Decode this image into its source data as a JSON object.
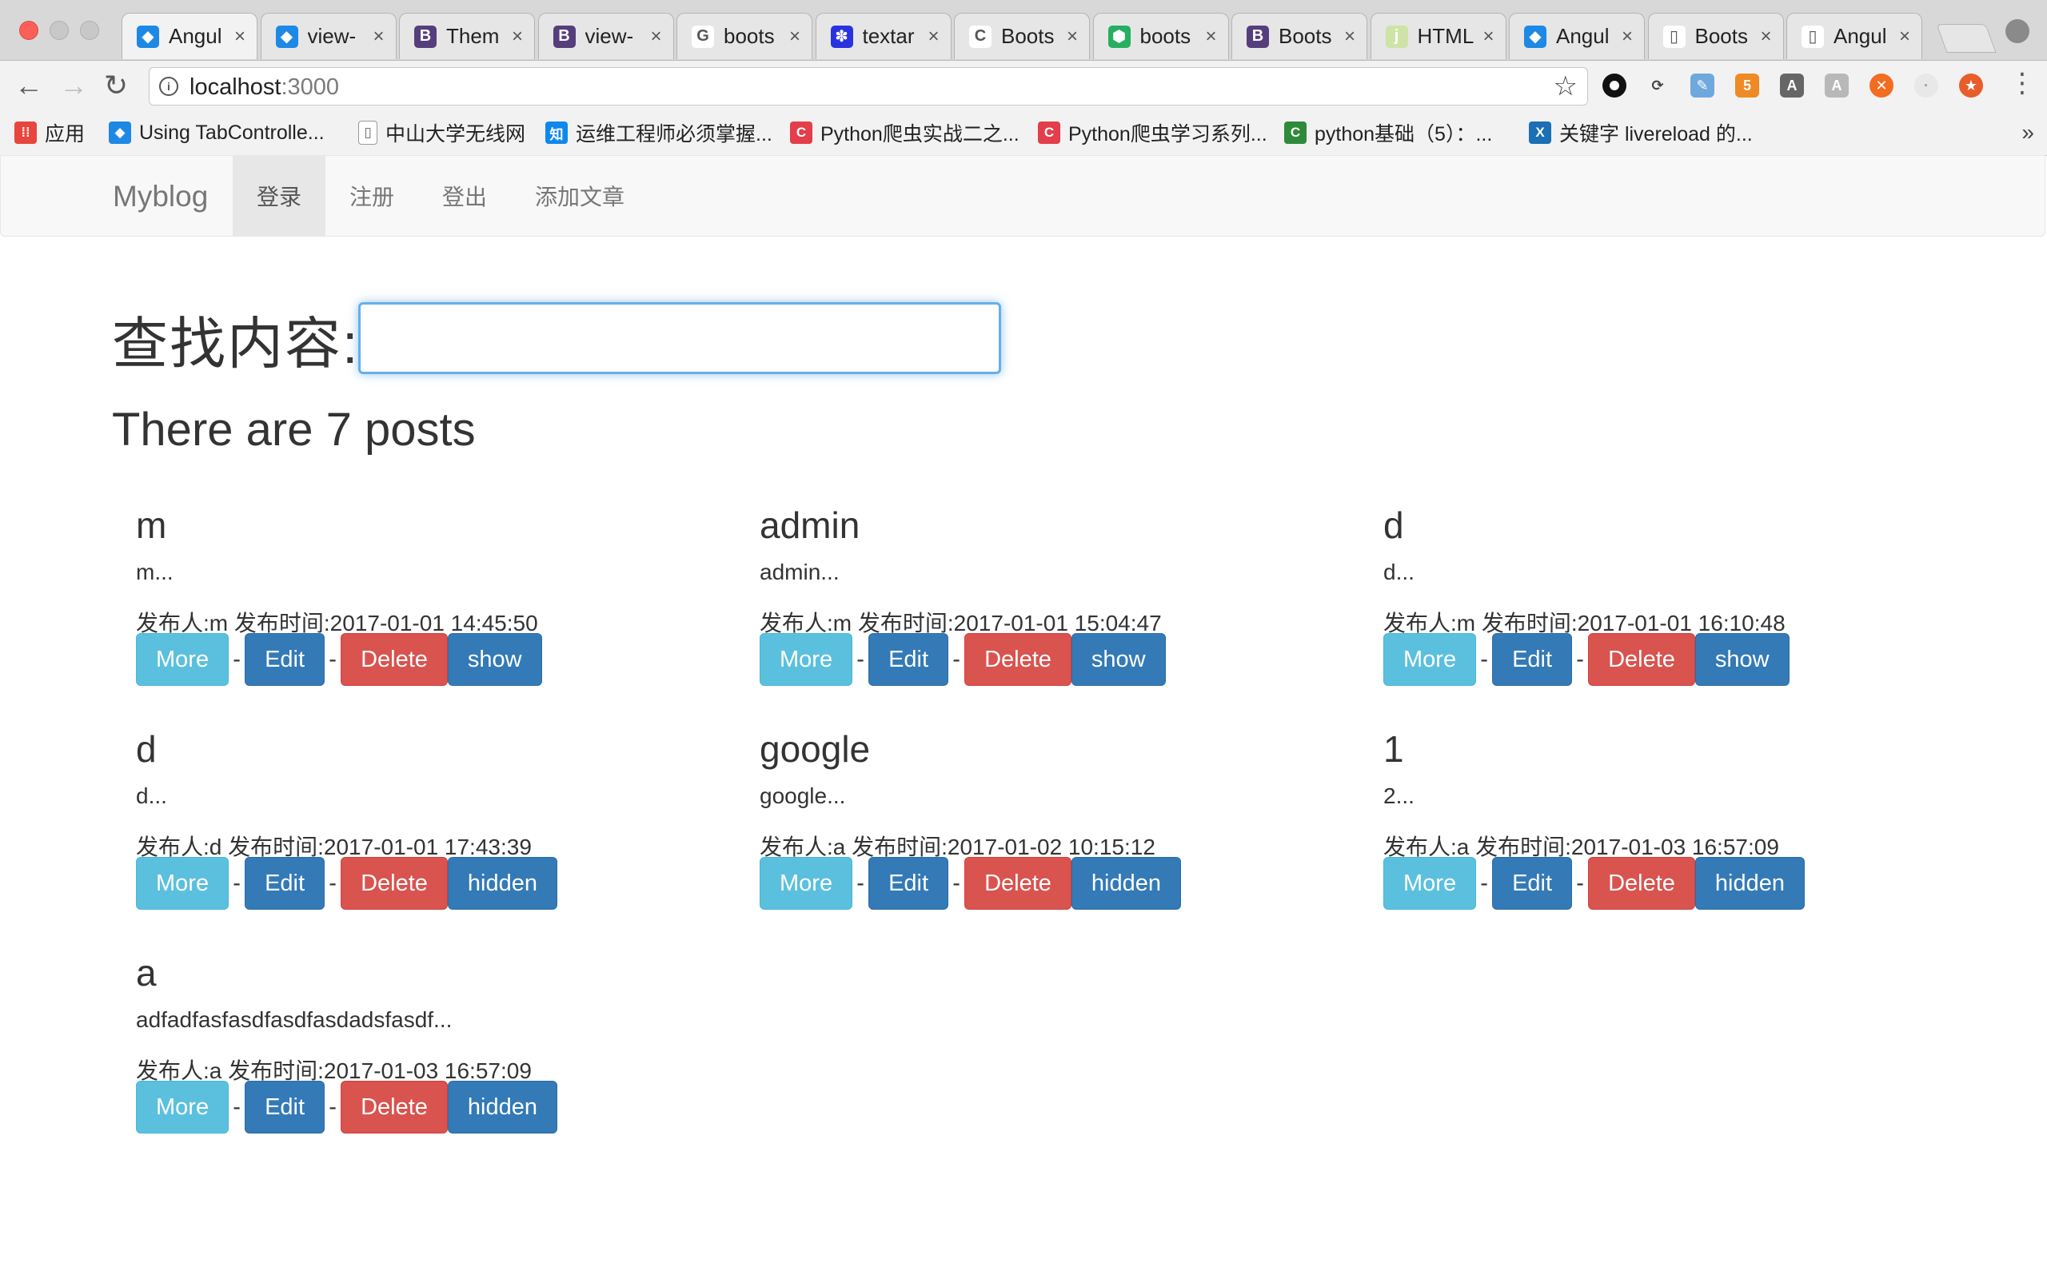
{
  "browser": {
    "tabs": [
      {
        "title": "Angul",
        "icon": "angular-icon",
        "color": "#1e88e5",
        "glyph": "◆"
      },
      {
        "title": "view-",
        "icon": "angular-icon",
        "color": "#1e88e5",
        "glyph": "◆"
      },
      {
        "title": "Them",
        "icon": "bootstrap-icon",
        "color": "#563d7c",
        "glyph": "B"
      },
      {
        "title": "view-",
        "icon": "bootstrap-icon",
        "color": "#563d7c",
        "glyph": "B"
      },
      {
        "title": "boots",
        "icon": "google-icon",
        "color": "#ffffff",
        "glyph": "G"
      },
      {
        "title": "textar",
        "icon": "baidu-icon",
        "color": "#2932e1",
        "glyph": "✽"
      },
      {
        "title": "Boots",
        "icon": "cnblogs-icon",
        "color": "#ffffff",
        "glyph": "C"
      },
      {
        "title": "boots",
        "icon": "hex-icon",
        "color": "#27ae60",
        "glyph": "⬢"
      },
      {
        "title": "Boots",
        "icon": "bootstrap-icon",
        "color": "#563d7c",
        "glyph": "B"
      },
      {
        "title": "HTML",
        "icon": "jsfiddle-icon",
        "color": "#cde4a6",
        "glyph": "j"
      },
      {
        "title": "Angul",
        "icon": "angular-icon",
        "color": "#1e88e5",
        "glyph": "◆"
      },
      {
        "title": "Boots",
        "icon": "page-icon",
        "color": "#ffffff",
        "glyph": "▯"
      },
      {
        "title": "Angul",
        "icon": "page-icon",
        "color": "#ffffff",
        "glyph": "▯"
      }
    ],
    "close_glyph": "×",
    "url_host": "localhost",
    "url_port": ":3000",
    "info_glyph": "i",
    "star_glyph": "☆",
    "back_glyph": "←",
    "forward_glyph": "→",
    "reload_glyph": "↻",
    "bookmarks": [
      {
        "label": "应用",
        "icon": "apps-grid-icon",
        "color": "#e8453c",
        "glyph": "⁞⁞"
      },
      {
        "label": "Using TabControlle...",
        "icon": "angular-icon",
        "color": "#1e88e5",
        "glyph": "◆"
      },
      {
        "label": "中山大学无线网",
        "icon": "page-icon",
        "color": "#ffffff",
        "glyph": "▯"
      },
      {
        "label": "运维工程师必须掌握...",
        "icon": "zhihu-icon",
        "color": "#0f88eb",
        "glyph": "知"
      },
      {
        "label": "Python爬虫实战二之...",
        "icon": "cnblogs-icon",
        "color": "#e33e4b",
        "glyph": "C"
      },
      {
        "label": "Python爬虫学习系列...",
        "icon": "cnblogs-icon",
        "color": "#e33e4b",
        "glyph": "C"
      },
      {
        "label": "python基础（5）：...",
        "icon": "csdn-icon",
        "color": "#2e8b3a",
        "glyph": "C"
      },
      {
        "label": "关键字 livereload 的...",
        "icon": "x-icon",
        "color": "#1a6fb5",
        "glyph": "X"
      }
    ],
    "bookmarks_more": "»"
  },
  "navbar": {
    "brand": "Myblog",
    "items": [
      {
        "label": "登录",
        "active": true
      },
      {
        "label": "注册",
        "active": false
      },
      {
        "label": "登出",
        "active": false
      },
      {
        "label": "添加文章",
        "active": false
      }
    ]
  },
  "search": {
    "label": "查找内容:",
    "value": ""
  },
  "post_count_text": "There are 7 posts",
  "buttons": {
    "more": "More",
    "edit": "Edit",
    "delete": "Delete",
    "separator": "-"
  },
  "posts": [
    {
      "title": "m",
      "excerpt": "m...",
      "meta": "发布人:m 发布时间:2017-01-01 14:45:50",
      "toggle": "show"
    },
    {
      "title": "admin",
      "excerpt": "admin...",
      "meta": "发布人:m 发布时间:2017-01-01 15:04:47",
      "toggle": "show"
    },
    {
      "title": "d",
      "excerpt": "d...",
      "meta": "发布人:m 发布时间:2017-01-01 16:10:48",
      "toggle": "show"
    },
    {
      "title": "d",
      "excerpt": "d...",
      "meta": "发布人:d 发布时间:2017-01-01 17:43:39",
      "toggle": "hidden"
    },
    {
      "title": "google",
      "excerpt": "google...",
      "meta": "发布人:a 发布时间:2017-01-02 10:15:12",
      "toggle": "hidden"
    },
    {
      "title": "1",
      "excerpt": "2...",
      "meta": "发布人:a 发布时间:2017-01-03 16:57:09",
      "toggle": "hidden"
    },
    {
      "title": "a",
      "excerpt": "adfadfasfasdfasdfasdadsfasdf...",
      "meta": "发布人:a 发布时间:2017-01-03 16:57:09",
      "toggle": "hidden"
    }
  ]
}
